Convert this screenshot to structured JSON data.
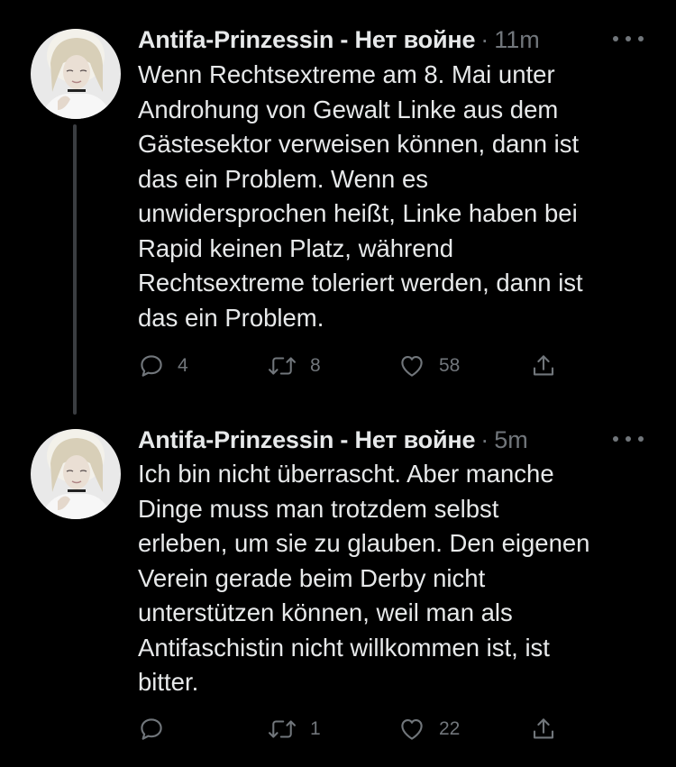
{
  "tweets": [
    {
      "author": "Antifa-Prinzessin - Нет войне",
      "separator": "·",
      "timestamp": "11m",
      "text_lines": [
        "Wenn Rechtsextreme am 8. Mai unter",
        "Androhung von Gewalt Linke aus dem",
        "Gästesektor verweisen können, dann ist",
        "das ein Problem. Wenn es",
        "unwidersprochen heißt, Linke haben bei",
        "Rapid keinen Platz, während",
        "Rechtsextreme toleriert werden, dann ist",
        "das ein Problem."
      ],
      "replies": "4",
      "retweets": "8",
      "likes": "58",
      "icons": {
        "reply": "reply-icon",
        "retweet": "retweet-icon",
        "like": "heart-icon",
        "share": "share-icon",
        "more": "more-icon"
      }
    },
    {
      "author": "Antifa-Prinzessin - Нет войне",
      "separator": "·",
      "timestamp": "5m",
      "text_lines": [
        "Ich bin nicht überrascht. Aber manche",
        "Dinge muss man trotzdem selbst",
        "erleben, um sie zu glauben. Den eigenen",
        "Verein gerade beim Derby nicht",
        "unterstützen können, weil man als",
        "Antifaschistin nicht willkommen ist, ist",
        "bitter."
      ],
      "replies": "",
      "retweets": "1",
      "likes": "22",
      "icons": {
        "reply": "reply-icon",
        "retweet": "retweet-icon",
        "like": "heart-icon",
        "share": "share-icon",
        "more": "more-icon"
      }
    }
  ],
  "colors": {
    "background": "#000000",
    "text": "#e7e9ea",
    "muted": "#71767b",
    "thread_line": "#3a3d41"
  }
}
